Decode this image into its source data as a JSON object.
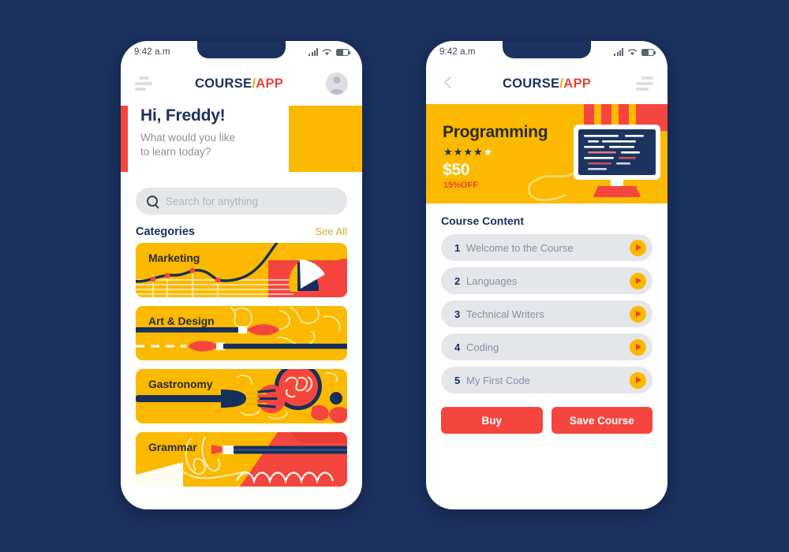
{
  "colors": {
    "background": "#1b3160",
    "navy": "#1b3160",
    "yellow": "#fbb900",
    "red": "#f4463f",
    "accent_red": "#ee3f37",
    "gray_pill": "#e4e6ea",
    "gray_text": "#8b90a0",
    "see_all": "#d6a92e"
  },
  "status_bar": {
    "time": "9:42 a.m",
    "icons": [
      "signal-icon",
      "wifi-icon",
      "battery-icon"
    ]
  },
  "brand": {
    "part1": "COURSE",
    "slash": "/",
    "part2": "APP"
  },
  "home_screen": {
    "menu_icon": "hamburger-menu-icon",
    "avatar_icon": "user-avatar-icon",
    "greeting": "Hi, Freddy!",
    "subgreeting": "What would you like\nto learn today?",
    "search": {
      "icon": "search-icon",
      "placeholder": "Search for anything",
      "value": ""
    },
    "categories_heading": "Categories",
    "see_all_label": "See All",
    "categories": [
      {
        "label": "Marketing",
        "art": "chart-pie-illustration"
      },
      {
        "label": "Art & Design",
        "art": "paintbrush-illustration"
      },
      {
        "label": "Gastronomy",
        "art": "fork-plate-illustration"
      },
      {
        "label": "Grammar",
        "art": "pencil-illustration"
      }
    ]
  },
  "detail_screen": {
    "back_icon": "back-arrow-icon",
    "menu_icon": "hamburger-menu-icon",
    "course": {
      "title": "Programming",
      "rating_filled": 4,
      "rating_total": 5,
      "price": "$50",
      "discount": "15%OFF",
      "art": "computer-monitor-code-illustration"
    },
    "content_heading": "Course Content",
    "lessons": [
      {
        "num": "1",
        "label": "Welcome to the Course",
        "play": "play-icon"
      },
      {
        "num": "2",
        "label": "Languages",
        "play": "play-icon"
      },
      {
        "num": "3",
        "label": "Technical Writers",
        "play": "play-icon"
      },
      {
        "num": "4",
        "label": "Coding",
        "play": "play-icon"
      },
      {
        "num": "5",
        "label": "My First Code",
        "play": "play-icon"
      }
    ],
    "buy_label": "Buy",
    "save_label": "Save Course"
  }
}
